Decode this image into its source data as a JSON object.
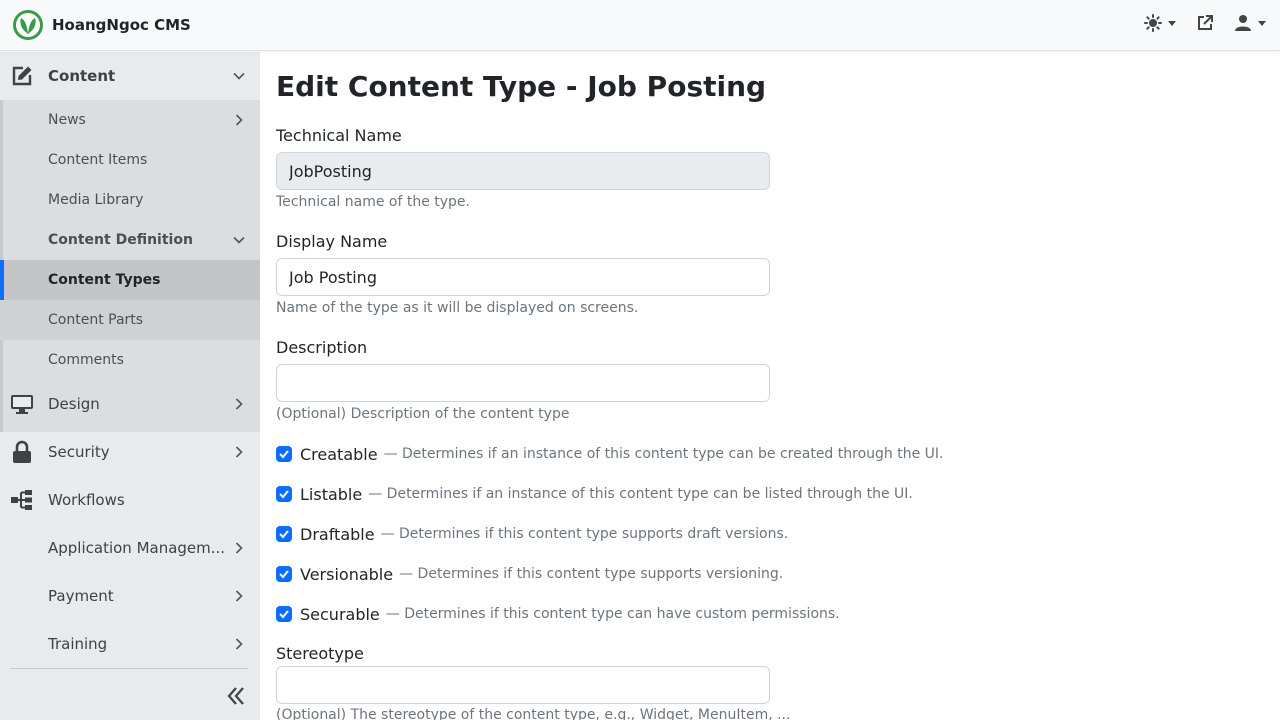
{
  "app": {
    "title": "HoangNgoc CMS"
  },
  "topbar": {
    "theme_icon": "sun-icon",
    "visit_site_icon": "external-link-icon",
    "user_icon": "user-icon"
  },
  "sidebar": {
    "content": {
      "label": "Content",
      "icon": "edit-icon",
      "expanded": true
    },
    "sub_items": [
      {
        "label": "News",
        "has_children": true
      },
      {
        "label": "Content Items"
      },
      {
        "label": "Media Library"
      },
      {
        "label": "Content Definition",
        "expanded": true
      },
      {
        "label": "Content Types",
        "active": true
      },
      {
        "label": "Content Parts"
      },
      {
        "label": "Comments"
      }
    ],
    "sections": [
      {
        "label": "Design",
        "icon": "desktop-icon"
      },
      {
        "label": "Security",
        "icon": "lock-icon"
      },
      {
        "label": "Workflows",
        "icon": "workflow-icon"
      },
      {
        "label": "Application Managem..."
      },
      {
        "label": "Payment"
      },
      {
        "label": "Training"
      }
    ],
    "collapse_icon": "double-chevron-left-icon"
  },
  "page": {
    "title": "Edit Content Type - Job Posting",
    "technical_name": {
      "label": "Technical Name",
      "value": "JobPosting",
      "hint": "Technical name of the type."
    },
    "display_name": {
      "label": "Display Name",
      "value": "Job Posting",
      "hint": "Name of the type as it will be displayed on screens."
    },
    "description": {
      "label": "Description",
      "value": "",
      "hint": "(Optional) Description of the content type"
    },
    "options": [
      {
        "label": "Creatable",
        "desc": "— Determines if an instance of this content type can be created through the UI.",
        "checked": true
      },
      {
        "label": "Listable",
        "desc": "— Determines if an instance of this content type can be listed through the UI.",
        "checked": true
      },
      {
        "label": "Draftable",
        "desc": "— Determines if this content type supports draft versions.",
        "checked": true
      },
      {
        "label": "Versionable",
        "desc": "— Determines if this content type supports versioning.",
        "checked": true
      },
      {
        "label": "Securable",
        "desc": "— Determines if this content type can have custom permissions.",
        "checked": true
      }
    ],
    "stereotype": {
      "label": "Stereotype",
      "value": "",
      "hint": "(Optional) The stereotype of the content type, e.g., Widget, MenuItem, ..."
    }
  },
  "colors": {
    "primary": "#0d6efd",
    "sidebar_bg": "#e9eaeb",
    "active_bg": "#c4c5c7",
    "brand_green": "#3a9a4a"
  }
}
